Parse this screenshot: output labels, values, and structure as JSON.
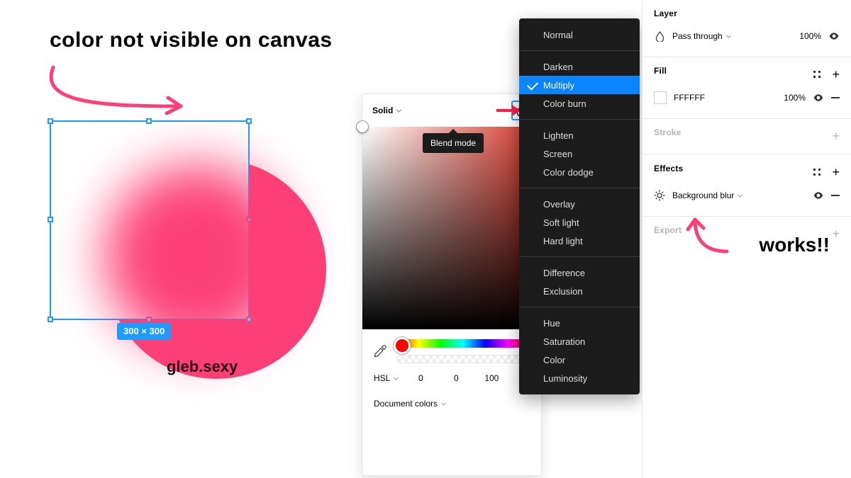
{
  "annotations": {
    "top": "color not visible on canvas",
    "right": "works!!",
    "watermark": "gleb.sexy"
  },
  "canvas": {
    "selection_dimensions": "300 × 300"
  },
  "picker": {
    "fill_type": "Solid",
    "tooltip": "Blend mode",
    "color_model": "HSL",
    "h": "0",
    "s": "0",
    "l": "100",
    "doc_colors_label": "Document colors"
  },
  "blend_menu": {
    "selected": "Multiply",
    "groups": [
      [
        "Normal"
      ],
      [
        "Darken",
        "Multiply",
        "Color burn"
      ],
      [
        "Lighten",
        "Screen",
        "Color dodge"
      ],
      [
        "Overlay",
        "Soft light",
        "Hard light"
      ],
      [
        "Difference",
        "Exclusion"
      ],
      [
        "Hue",
        "Saturation",
        "Color",
        "Luminosity"
      ]
    ]
  },
  "inspector": {
    "layer": {
      "title": "Layer",
      "mode": "Pass through",
      "opacity": "100%"
    },
    "fill": {
      "title": "Fill",
      "hex": "FFFFFF",
      "opacity": "100%"
    },
    "stroke": {
      "title": "Stroke"
    },
    "effects": {
      "title": "Effects",
      "effect_name": "Background blur"
    },
    "export": {
      "title": "Export"
    }
  },
  "colors": {
    "pink": "#fc4077",
    "selection": "#1e9bff",
    "menu_highlight": "#0a84ff"
  }
}
